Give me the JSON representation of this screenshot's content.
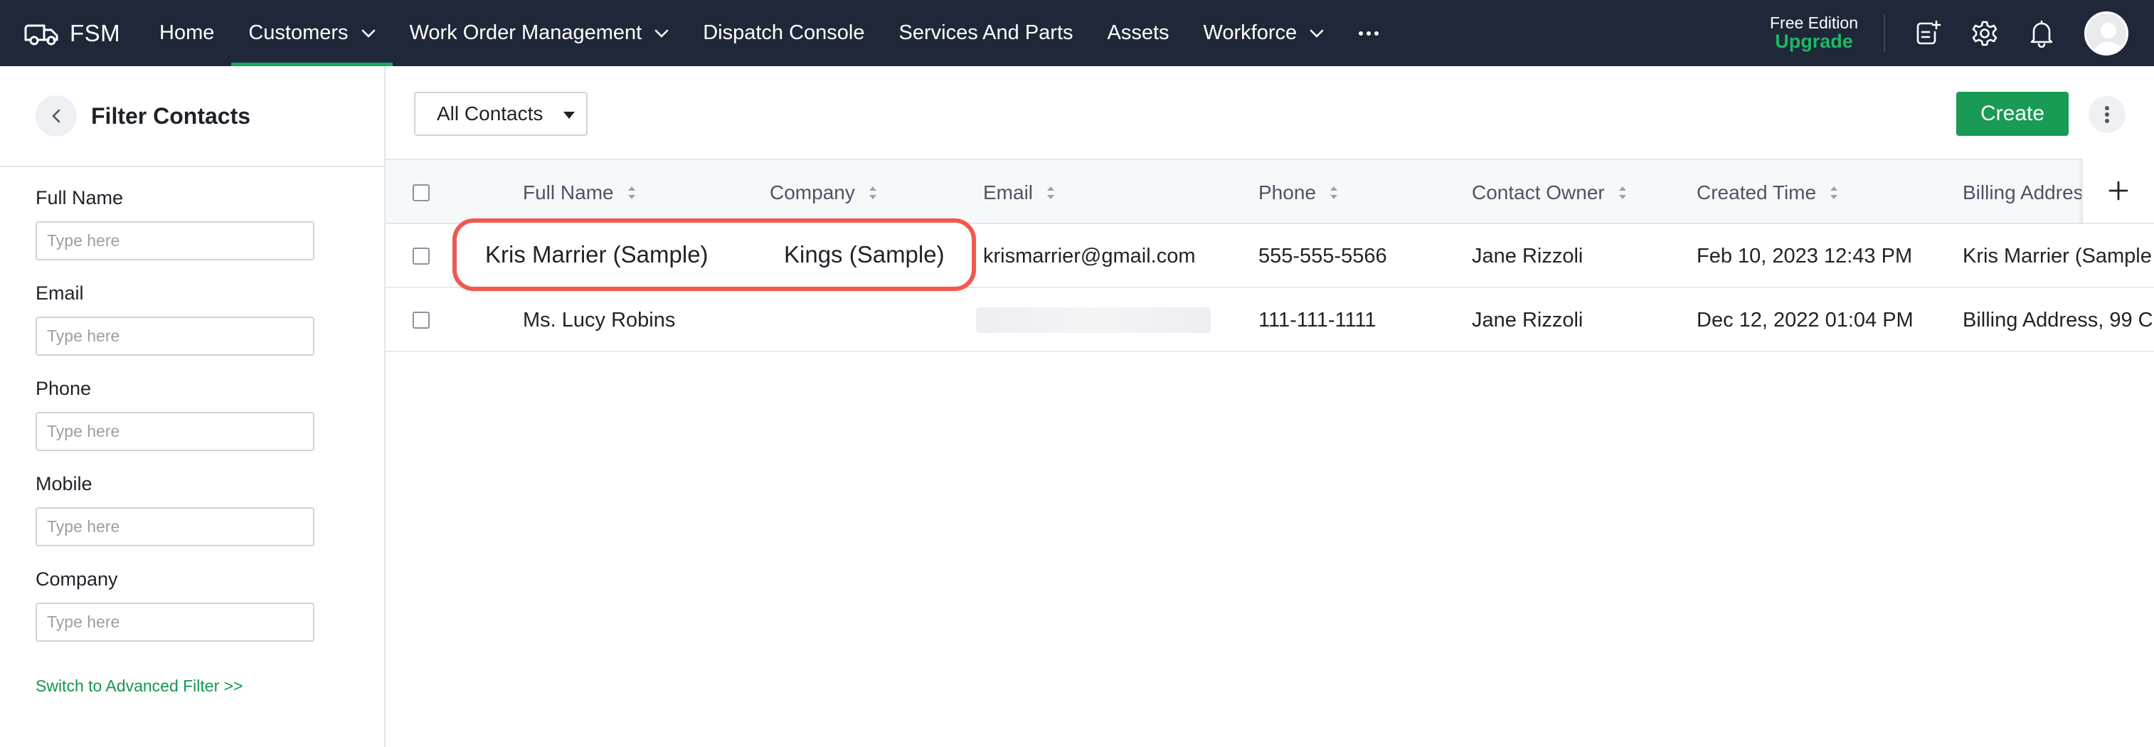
{
  "app": {
    "brand": "FSM",
    "brand_icon": "truck-icon"
  },
  "nav": {
    "items": [
      {
        "label": "Home",
        "has_dropdown": false,
        "active": false
      },
      {
        "label": "Customers",
        "has_dropdown": true,
        "active": true
      },
      {
        "label": "Work Order Management",
        "has_dropdown": true,
        "active": false
      },
      {
        "label": "Dispatch Console",
        "has_dropdown": false,
        "active": false
      },
      {
        "label": "Services And Parts",
        "has_dropdown": false,
        "active": false
      },
      {
        "label": "Assets",
        "has_dropdown": false,
        "active": false
      },
      {
        "label": "Workforce",
        "has_dropdown": true,
        "active": false
      }
    ],
    "more_icon": "more-horizontal-icon",
    "edition_label": "Free Edition",
    "upgrade_label": "Upgrade",
    "right_icons": [
      "notes-add-icon",
      "gear-icon",
      "bell-icon"
    ],
    "accent_color": "#1aa561"
  },
  "filter_panel": {
    "title": "Filter Contacts",
    "fields": [
      {
        "label": "Full Name",
        "placeholder": "Type here"
      },
      {
        "label": "Email",
        "placeholder": "Type here"
      },
      {
        "label": "Phone",
        "placeholder": "Type here"
      },
      {
        "label": "Mobile",
        "placeholder": "Type here"
      },
      {
        "label": "Company",
        "placeholder": "Type here"
      }
    ],
    "advanced_link": "Switch to Advanced Filter >>"
  },
  "toolbar": {
    "view_selected": "All Contacts",
    "create_label": "Create"
  },
  "table": {
    "columns": [
      "Full Name",
      "Company",
      "Email",
      "Phone",
      "Contact Owner",
      "Created Time",
      "Billing Address"
    ],
    "rows": [
      {
        "full_name": "Kris Marrier (Sample)",
        "company": "Kings (Sample)",
        "email": "krismarrier@gmail.com",
        "phone": "555-555-5566",
        "owner": "Jane Rizzoli",
        "created": "Feb 10, 2023 12:43 PM",
        "billing": "Kris Marrier (Sample"
      },
      {
        "full_name": "Ms. Lucy Robins",
        "company": "",
        "email": "",
        "phone": "111-111-1111",
        "owner": "Jane Rizzoli",
        "created": "Dec 12, 2022 01:04 PM",
        "billing": "Billing Address, 99 C"
      }
    ]
  },
  "highlight_color": "#ef5a4f",
  "primary_button_color": "#1a9b55"
}
